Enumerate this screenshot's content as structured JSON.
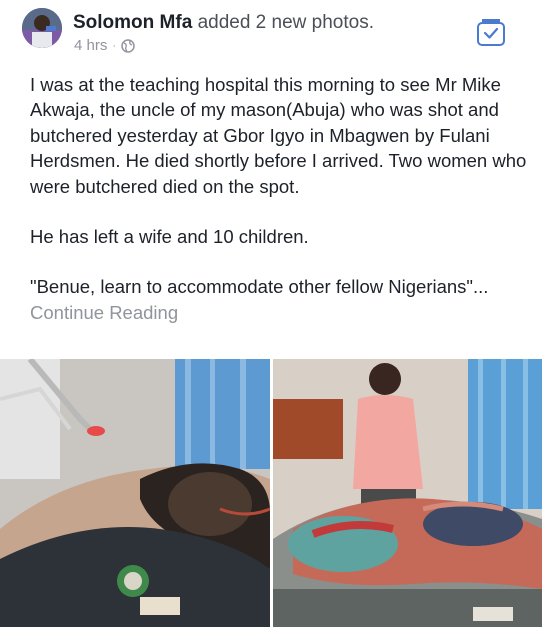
{
  "post": {
    "author": "Solomon Mfa",
    "action": "added 2 new photos.",
    "timestamp": "4 hrs",
    "separator": "·",
    "privacy_icon": "globe-icon",
    "save_icon": "saved-icon",
    "paragraphs": [
      "I was at the teaching hospital this morning to see Mr Mike Akwaja, the uncle of my mason(Abuja) who was shot and butchered yesterday at Gbor Igyo in Mbagwen by Fulani Herdsmen. He died shortly before I arrived. Two women who were butchered died on the spot.",
      "He has left a wife and 10 children."
    ],
    "last_paragraph": "\"Benue, learn to accommodate other fellow Nigerians\"...",
    "continue_label": "Continue Reading"
  },
  "colors": {
    "text": "#1d2129",
    "secondary": "#90949c",
    "accent": "#4a7bd0"
  }
}
